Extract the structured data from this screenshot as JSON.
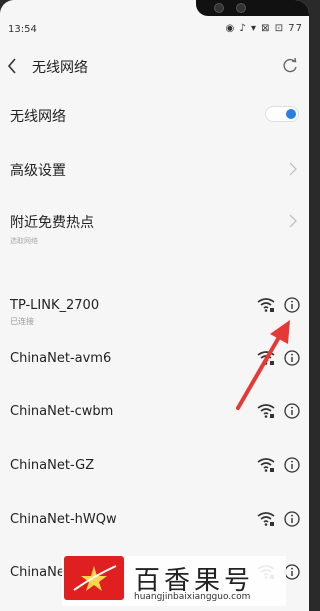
{
  "status_bar": {
    "time": "13:54",
    "icons": "◉ ♪ ▾ ⊠ ⊡ 77"
  },
  "header": {
    "title": "无线网络"
  },
  "settings": [
    {
      "label": "无线网络",
      "type": "toggle",
      "on": true
    },
    {
      "label": "高级设置",
      "type": "link"
    },
    {
      "label": "附近免费热点",
      "type": "link"
    }
  ],
  "section_label": "选取网络",
  "networks": [
    {
      "ssid": "TP-LINK_2700",
      "status": "已连接"
    },
    {
      "ssid": "ChinaNet-avm6",
      "status": ""
    },
    {
      "ssid": "ChinaNet-cwbm",
      "status": ""
    },
    {
      "ssid": "ChinaNet-GZ",
      "status": ""
    },
    {
      "ssid": "ChinaNet-hWQw",
      "status": ""
    },
    {
      "ssid": "ChinaNe",
      "status": ""
    }
  ],
  "watermark": {
    "text": "百香果号",
    "url": "huangjinbaixiangguo.com"
  },
  "colors": {
    "accent": "#2a7de1",
    "annotation_arrow": "#e53935"
  }
}
